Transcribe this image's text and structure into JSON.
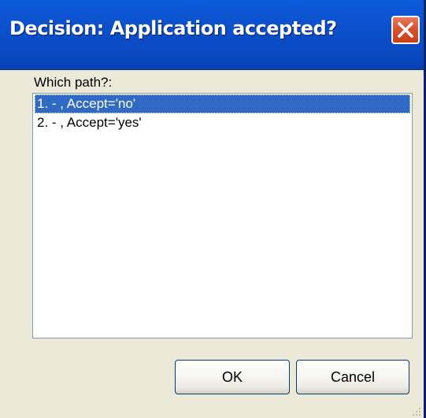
{
  "window": {
    "title": "Decision: Application accepted?",
    "close_icon": "close-icon"
  },
  "prompt": {
    "label": "Which path?:"
  },
  "paths": {
    "items": [
      {
        "label": "1. - , Accept='no'",
        "selected": true
      },
      {
        "label": "2. - , Accept='yes'",
        "selected": false
      }
    ]
  },
  "buttons": {
    "ok_label": "OK",
    "cancel_label": "Cancel"
  },
  "colors": {
    "titlebar": "#0b4ec8",
    "close_button": "#d9532f",
    "selection": "#316ac5",
    "dialog_background": "#ece9d8"
  }
}
